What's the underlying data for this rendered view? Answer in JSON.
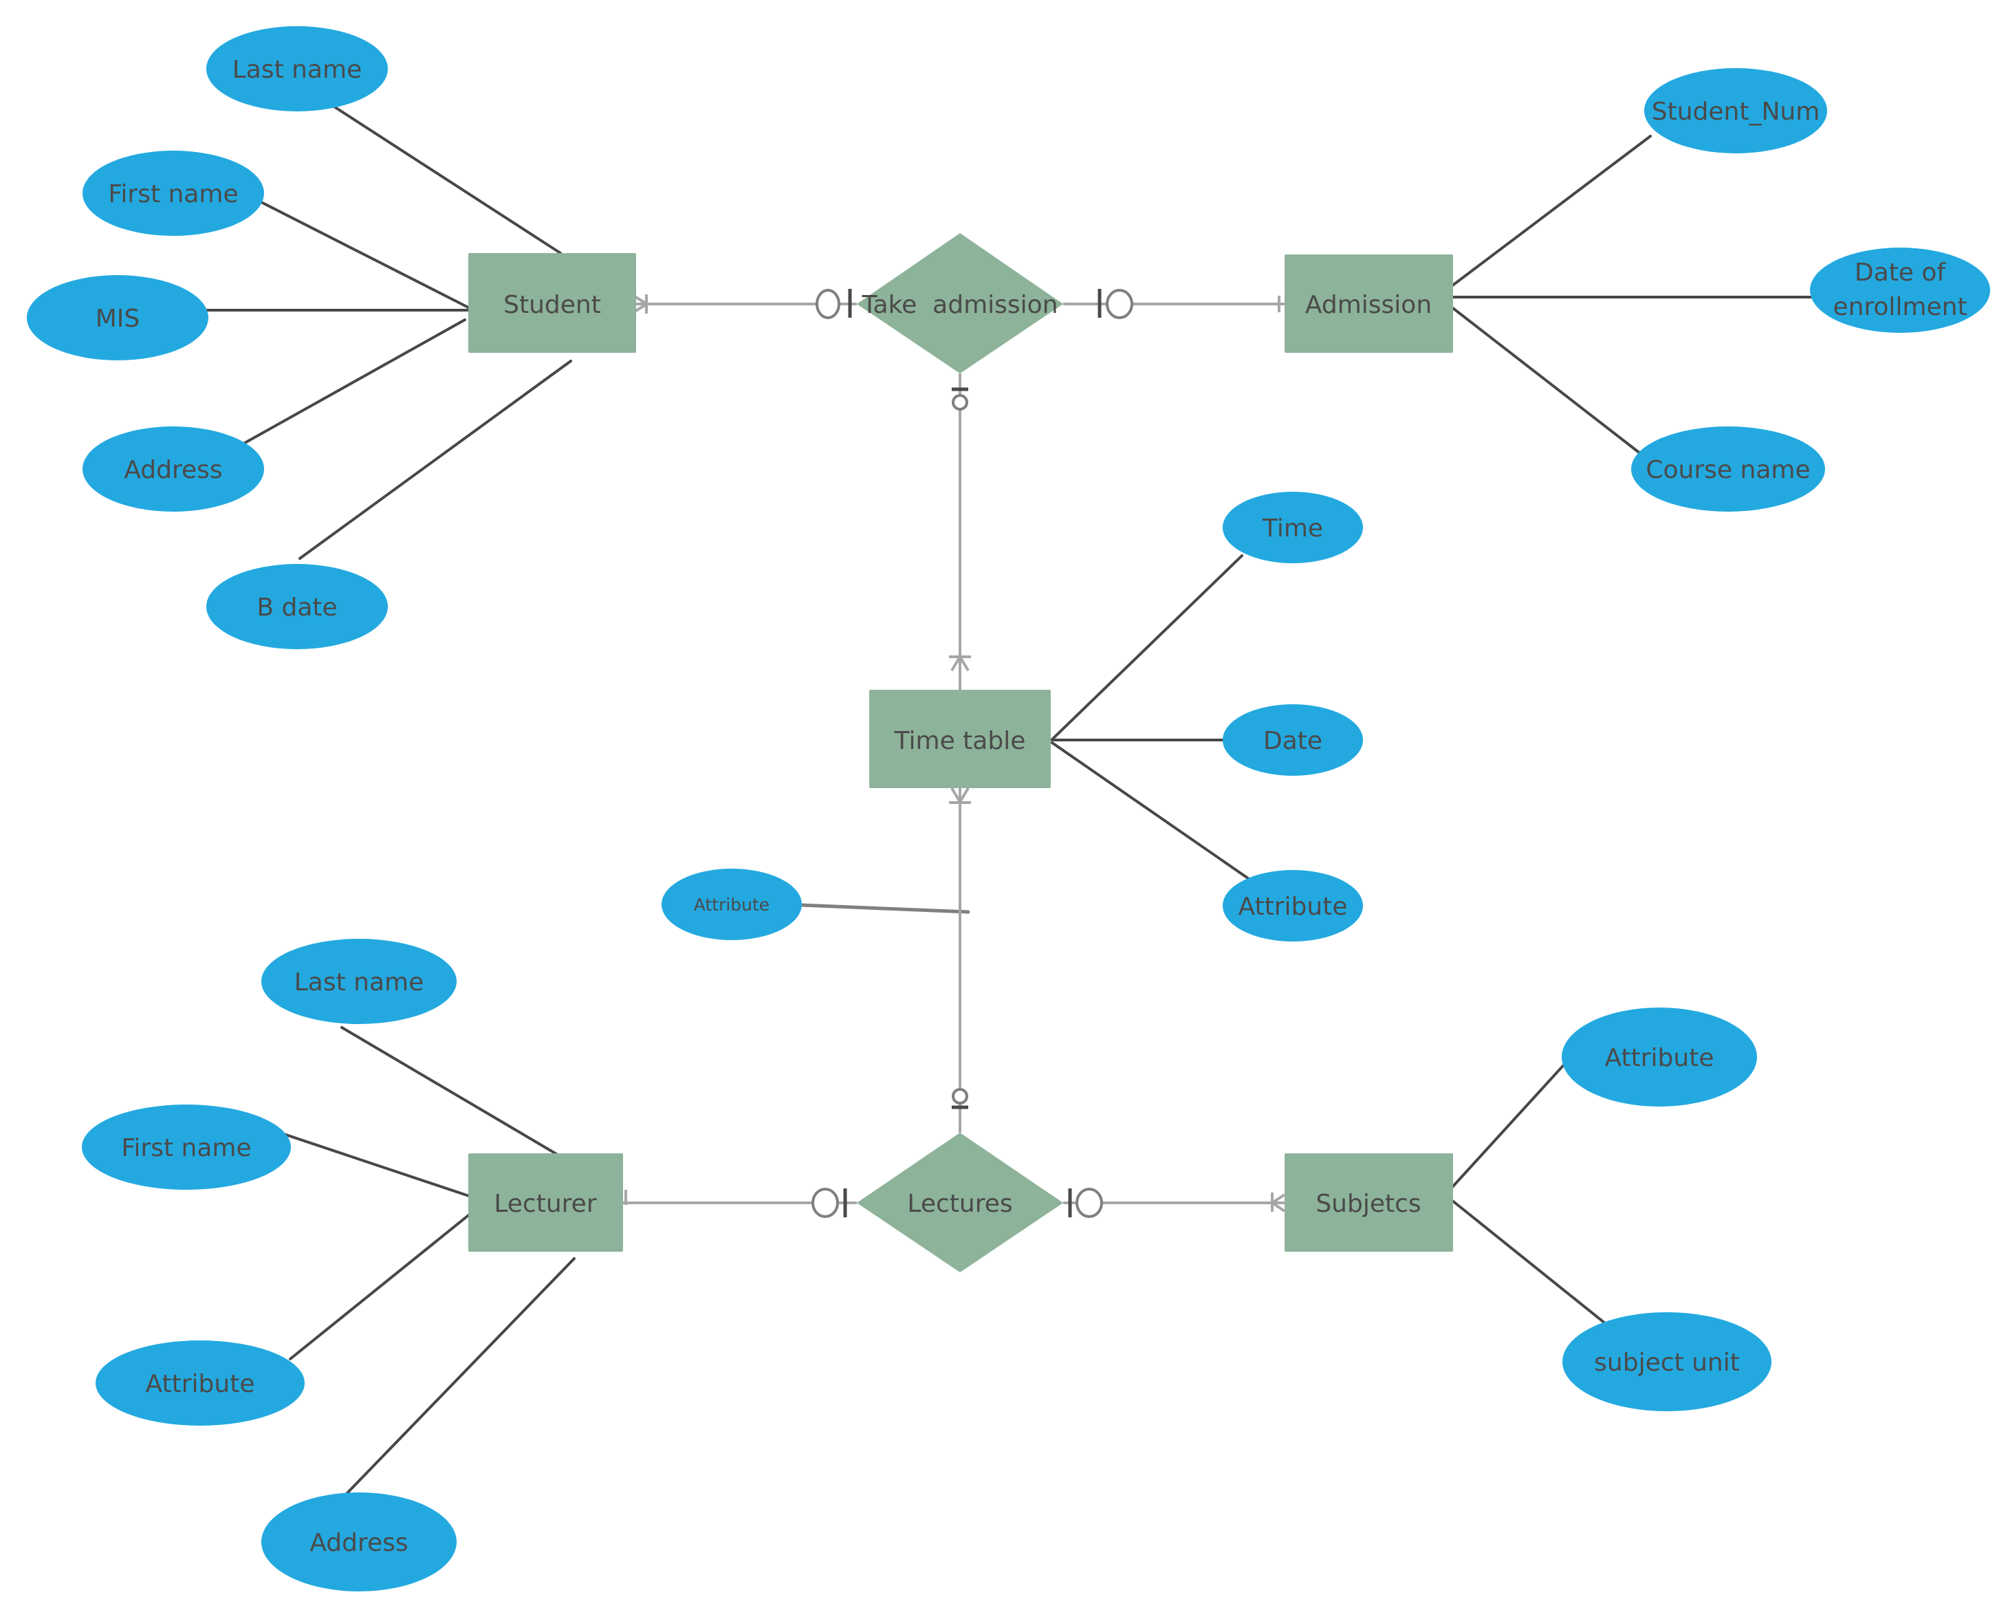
{
  "diagram": {
    "type": "entity-relationship",
    "colors": {
      "entity_fill": "#8db39a",
      "relationship_fill": "#8db39a",
      "attribute_fill": "#23a9e0",
      "text": "#4a4a4a",
      "attribute_link": "#474747",
      "relationship_link": "#a6a6a6"
    },
    "entities": [
      {
        "id": "student",
        "label": "Student"
      },
      {
        "id": "admission",
        "label": "Admission"
      },
      {
        "id": "timetable",
        "label": "Time table"
      },
      {
        "id": "lecturer",
        "label": "Lecturer"
      },
      {
        "id": "subjects",
        "label": "Subjetcs"
      }
    ],
    "relationships": [
      {
        "id": "take_admission",
        "label": "Take  admission"
      },
      {
        "id": "lectures",
        "label": "Lectures"
      }
    ],
    "attributes": {
      "student": [
        "Last name",
        "First name",
        "MIS",
        "Address",
        "B date"
      ],
      "admission": [
        "Student_Num",
        "Date of",
        "enrollment",
        "Course name"
      ],
      "timetable": [
        "Time",
        "Date",
        "Attribute"
      ],
      "timetable_link": [
        "Attribute"
      ],
      "lecturer": [
        "Last name",
        "First name",
        "Attribute",
        "Address"
      ],
      "subjects": [
        "Attribute",
        "subject unit"
      ]
    },
    "connections": [
      {
        "from": "Student",
        "to": "Take admission",
        "from_end": "one-or-many",
        "to_end": "zero-or-one"
      },
      {
        "from": "Take admission",
        "to": "Admission",
        "from_end": "zero-or-one",
        "to_end": "one"
      },
      {
        "from": "Take admission",
        "to": "Time table",
        "from_end": "zero-or-one",
        "to_end": "one-or-many"
      },
      {
        "from": "Time table",
        "to": "Lectures",
        "from_end": "one-or-many",
        "to_end": "zero-or-one"
      },
      {
        "from": "Lecturer",
        "to": "Lectures",
        "from_end": "one",
        "to_end": "zero-or-one"
      },
      {
        "from": "Lectures",
        "to": "Subjetcs",
        "from_end": "zero-or-one",
        "to_end": "one-or-many"
      }
    ]
  }
}
